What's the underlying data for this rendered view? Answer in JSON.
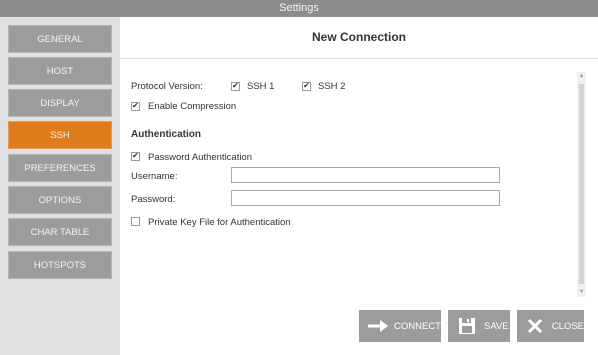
{
  "window": {
    "title": "Settings"
  },
  "sidebar": {
    "items": [
      {
        "label": "GENERAL",
        "active": false
      },
      {
        "label": "HOST",
        "active": false
      },
      {
        "label": "DISPLAY",
        "active": false
      },
      {
        "label": "SSH",
        "active": true
      },
      {
        "label": "PREFERENCES",
        "active": false
      },
      {
        "label": "OPTIONS",
        "active": false
      },
      {
        "label": "CHAR TABLE",
        "active": false
      },
      {
        "label": "HOTSPOTS",
        "active": false
      }
    ]
  },
  "header": {
    "title": "New Connection"
  },
  "form": {
    "protocol_label": "Protocol Version:",
    "ssh1": {
      "label": "SSH 1",
      "checked": true
    },
    "ssh2": {
      "label": "SSH 2",
      "checked": true
    },
    "compression": {
      "label": "Enable Compression",
      "checked": true
    },
    "auth_section": "Authentication",
    "password_auth": {
      "label": "Password Authentication",
      "checked": true
    },
    "username": {
      "label": "Username:",
      "value": ""
    },
    "password": {
      "label": "Password:",
      "value": ""
    },
    "private_key": {
      "label": "Private Key File for Authentication",
      "checked": false
    }
  },
  "buttons": {
    "connect": "CONNECT",
    "save": "SAVE",
    "close": "CLOSE"
  },
  "colors": {
    "accent": "#e07b1e",
    "button": "#9c9c9c",
    "titlebar": "#8c8c8c"
  },
  "icons": {
    "connect": "arrow-right-icon",
    "save": "floppy-disk-icon",
    "close": "close-x-icon"
  }
}
